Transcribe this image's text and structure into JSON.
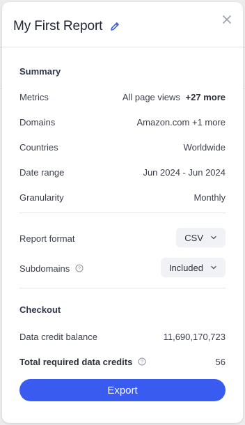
{
  "report": {
    "title": "My First Report"
  },
  "summary": {
    "heading": "Summary",
    "rows": [
      {
        "label": "Metrics",
        "value": "All page views",
        "extra": "+27 more"
      },
      {
        "label": "Domains",
        "value": "Amazon.com +1 more"
      },
      {
        "label": "Countries",
        "value": "Worldwide"
      },
      {
        "label": "Date range",
        "value": "Jun 2024 - Jun 2024"
      },
      {
        "label": "Granularity",
        "value": "Monthly"
      }
    ]
  },
  "options": {
    "report_format": {
      "label": "Report format",
      "value": "CSV"
    },
    "subdomains": {
      "label": "Subdomains",
      "value": "Included"
    }
  },
  "checkout": {
    "heading": "Checkout",
    "balance_label": "Data credit balance",
    "balance_value": "11,690,170,723",
    "required_label": "Total required data credits",
    "required_value": "56"
  },
  "actions": {
    "export_label": "Export"
  },
  "colors": {
    "accent": "#3a5bef"
  },
  "icons": [
    "pencil-icon",
    "close-icon",
    "info-icon",
    "chevron-down-icon"
  ]
}
